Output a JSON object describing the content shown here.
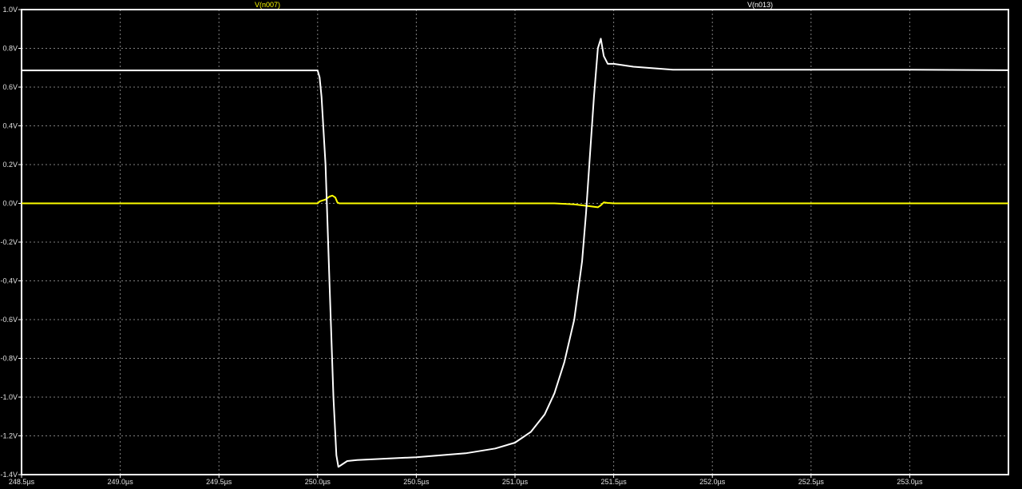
{
  "chart_data": {
    "type": "line",
    "title": "",
    "xlabel": "",
    "ylabel": "",
    "xlim": [
      248.5,
      253.5
    ],
    "ylim": [
      -1.4,
      1.0
    ],
    "grid": true,
    "x_ticks": [
      248.5,
      249.0,
      249.5,
      250.0,
      250.5,
      251.0,
      251.5,
      252.0,
      252.5,
      253.0
    ],
    "x_tick_labels": [
      "248.5µs",
      "249.0µs",
      "249.5µs",
      "250.0µs",
      "250.5µs",
      "251.0µs",
      "251.5µs",
      "252.0µs",
      "252.5µs",
      "253.0µs"
    ],
    "y_ticks": [
      1.0,
      0.8,
      0.6,
      0.4,
      0.2,
      0.0,
      -0.2,
      -0.4,
      -0.6,
      -0.8,
      -1.0,
      -1.2,
      -1.4
    ],
    "y_tick_labels": [
      "1.0V",
      "0.8V",
      "0.6V",
      "0.4V",
      "0.2V",
      "0.0V",
      "-0.2V",
      "-0.4V",
      "-0.6V",
      "-0.8V",
      "-1.0V",
      "-1.2V",
      "-1.4V"
    ],
    "legend_placement": "top",
    "series": [
      {
        "name": "V(n007)",
        "color": "#ffff00",
        "x": [
          248.5,
          250.0,
          250.01,
          250.04,
          250.06,
          250.075,
          250.09,
          250.1,
          250.11,
          251.2,
          251.3,
          251.38,
          251.42,
          251.435,
          251.45,
          251.47,
          251.5,
          253.5
        ],
        "y": [
          0.0,
          0.0,
          0.01,
          0.02,
          0.035,
          0.04,
          0.03,
          0.005,
          0.0,
          0.0,
          -0.005,
          -0.015,
          -0.02,
          -0.01,
          0.005,
          0.002,
          0.0,
          0.0
        ]
      },
      {
        "name": "V(n013)",
        "color": "#ffffff",
        "x": [
          248.5,
          250.0,
          250.01,
          250.02,
          250.04,
          250.06,
          250.08,
          250.095,
          250.105,
          250.12,
          250.15,
          250.2,
          250.5,
          250.75,
          250.9,
          251.0,
          251.08,
          251.15,
          251.2,
          251.25,
          251.3,
          251.34,
          251.36,
          251.38,
          251.4,
          251.42,
          251.435,
          251.45,
          251.47,
          251.5,
          251.6,
          251.8,
          252.2,
          253.0,
          253.5
        ],
        "y": [
          0.686,
          0.686,
          0.65,
          0.55,
          0.2,
          -0.4,
          -1.0,
          -1.3,
          -1.36,
          -1.35,
          -1.33,
          -1.325,
          -1.31,
          -1.29,
          -1.265,
          -1.235,
          -1.18,
          -1.09,
          -0.98,
          -0.82,
          -0.6,
          -0.3,
          -0.05,
          0.25,
          0.55,
          0.8,
          0.85,
          0.76,
          0.72,
          0.72,
          0.705,
          0.69,
          0.69,
          0.69,
          0.687
        ]
      }
    ]
  }
}
